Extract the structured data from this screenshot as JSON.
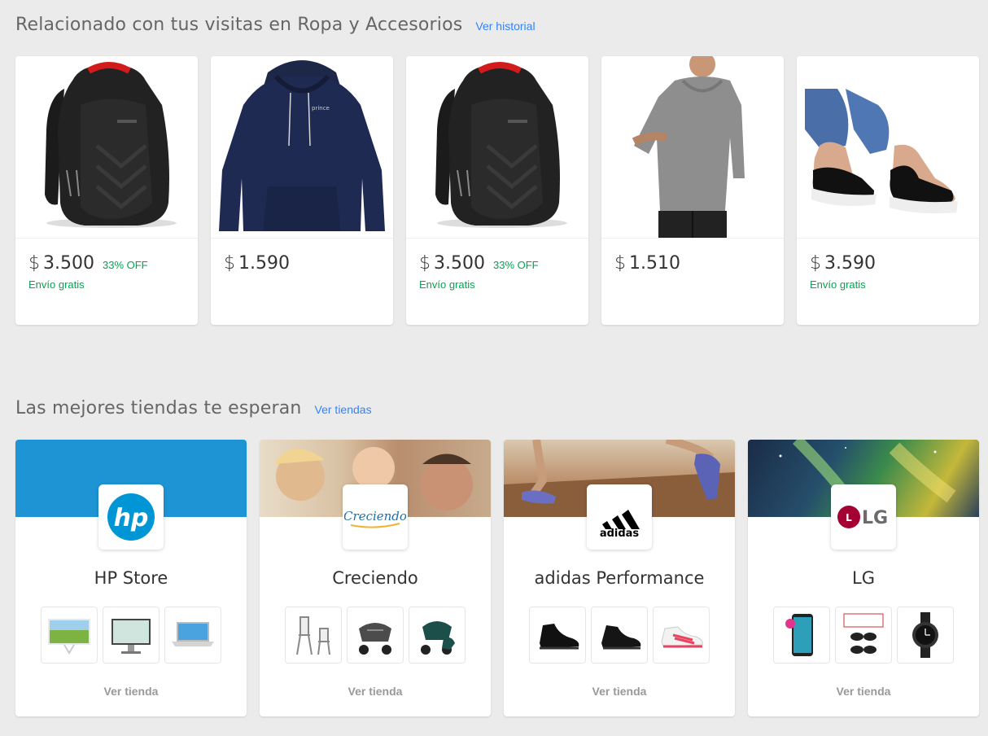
{
  "visits": {
    "title": "Relacionado con tus visitas en Ropa y Accesorios",
    "link": "Ver historial",
    "products": [
      {
        "image": "backpack-image",
        "currency": "$",
        "price": "3.500",
        "discount": "33% OFF",
        "shipping": "Envío gratis"
      },
      {
        "image": "navy-hoodie-image",
        "currency": "$",
        "price": "1.590",
        "discount": "",
        "shipping": ""
      },
      {
        "image": "backpack-image",
        "currency": "$",
        "price": "3.500",
        "discount": "33% OFF",
        "shipping": "Envío gratis"
      },
      {
        "image": "gray-hoodie-image",
        "currency": "$",
        "price": "1.510",
        "discount": "",
        "shipping": ""
      },
      {
        "image": "sandals-image",
        "currency": "$",
        "price": "3.590",
        "discount": "",
        "shipping": "Envío gratis"
      }
    ]
  },
  "stores": {
    "title": "Las mejores tiendas te esperan",
    "link": "Ver tiendas",
    "items": [
      {
        "name": "HP Store",
        "logo": "hp-logo",
        "cta": "Ver tienda",
        "banner_color": "#1e94d4",
        "thumbs": [
          "all-in-one-pc",
          "desktop-monitor",
          "laptop"
        ]
      },
      {
        "name": "Creciendo",
        "logo": "creciendo-logo",
        "logo_text": "Creciendo",
        "cta": "Ver tienda",
        "thumbs": [
          "high-chair",
          "stroller",
          "travel-system"
        ]
      },
      {
        "name": "adidas Performance",
        "logo": "adidas-logo",
        "logo_text": "adidas",
        "cta": "Ver tienda",
        "thumbs": [
          "black-cleat",
          "black-cleat-2",
          "white-pink-cleat"
        ]
      },
      {
        "name": "LG",
        "logo": "lg-logo",
        "logo_text": "LG",
        "cta": "Ver tienda",
        "thumbs": [
          "smartphone",
          "sunglasses",
          "smartwatch"
        ]
      }
    ]
  },
  "colors": {
    "link": "#3483fa",
    "green": "#00a650",
    "background": "#ebebeb"
  }
}
